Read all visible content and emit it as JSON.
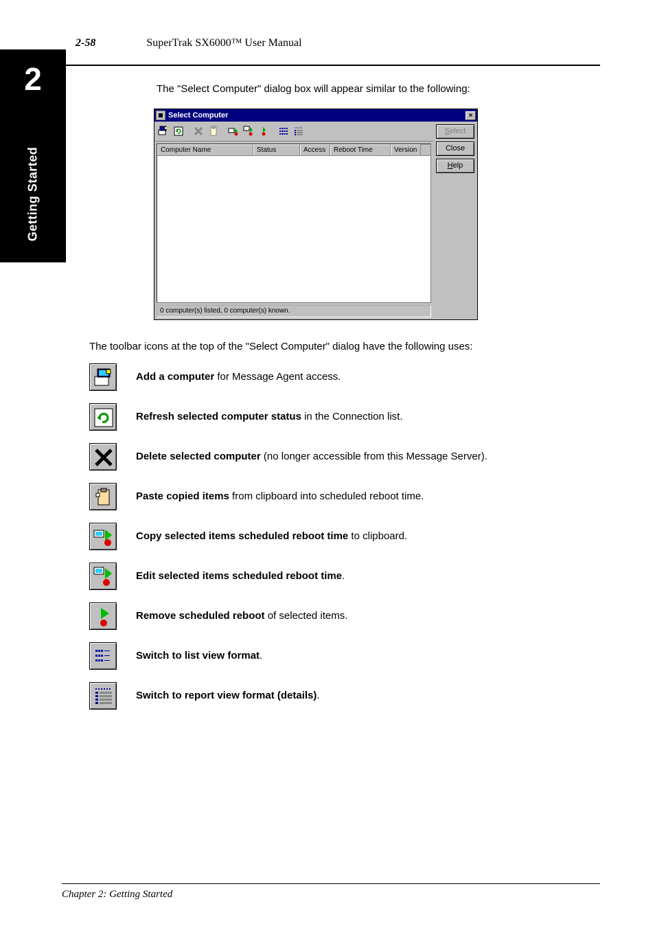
{
  "header": {
    "page_number": "2-58",
    "book_title": "SuperTrak SX6000™ User Manual"
  },
  "chapter_tab": {
    "number": "2",
    "label": "Getting Started"
  },
  "intro_text": "The \"Select Computer\" dialog box will appear similar to the following:",
  "dialog": {
    "title": "Select Computer",
    "toolbar_icons": [
      "add-computer",
      "refresh",
      "delete",
      "paste",
      "record-standard",
      "record-multi",
      "record-dot",
      "list",
      "details"
    ],
    "columns": {
      "name": "Computer Name",
      "status": "Status",
      "access": "Access",
      "reboot": "Reboot Time",
      "version": "Version"
    },
    "buttons": {
      "select": "Select",
      "close": "Close",
      "help": "Help"
    },
    "status_bar": "0 computer(s) listed, 0 computer(s) known."
  },
  "icons_intro": "The toolbar icons at the top of the \"Select Computer\" dialog have the following uses:",
  "icons": [
    {
      "key": "add-computer-icon",
      "label": "Add a computer",
      "desc": " for Message Agent access."
    },
    {
      "key": "refresh-icon",
      "label": "Refresh selected computer status",
      "desc": " in the Connection list."
    },
    {
      "key": "delete-icon",
      "label": "Delete selected computer",
      "desc": " (no longer accessible from this Message Server)."
    },
    {
      "key": "paste-icon",
      "label": "Paste copied items",
      "desc": " from clipboard into scheduled reboot time."
    },
    {
      "key": "copy-reboot-icon",
      "label": "Copy selected items scheduled reboot time",
      "desc": " to clipboard."
    },
    {
      "key": "edit-reboot-icon",
      "label": "Edit selected items scheduled reboot time",
      "desc": "."
    },
    {
      "key": "remove-reboot-icon",
      "label": "Remove scheduled reboot",
      "desc": " of selected items."
    },
    {
      "key": "list-view-icon",
      "label": "Switch to list view format",
      "desc": "."
    },
    {
      "key": "details-view-icon",
      "label": "Switch to report view format (details)",
      "desc": "."
    }
  ],
  "footer": "Chapter 2: Getting Started"
}
